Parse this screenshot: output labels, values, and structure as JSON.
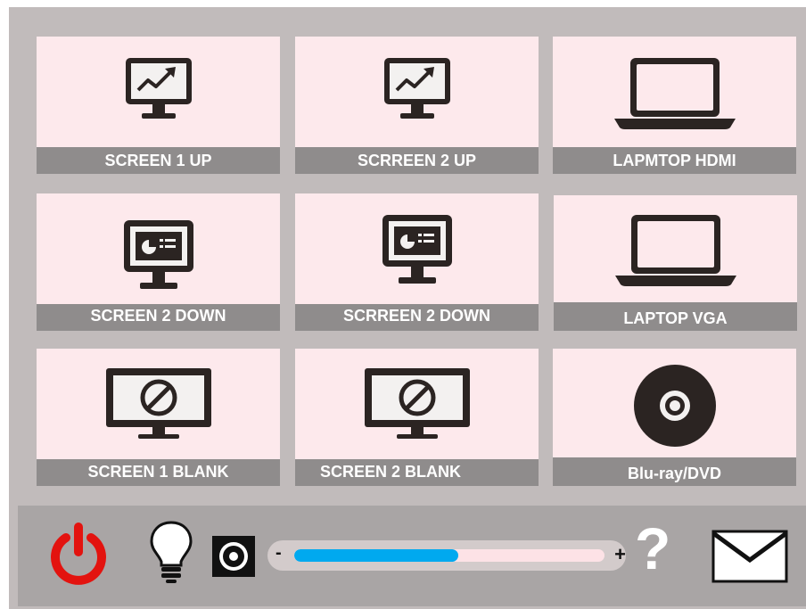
{
  "sources": [
    {
      "label": "SCREEN  1 UP",
      "icon": "monitor-chart-icon"
    },
    {
      "label": "SCRREEN  2 UP",
      "icon": "monitor-chart-icon"
    },
    {
      "label": "LAPMTOP HDMI",
      "icon": "laptop-icon"
    },
    {
      "label": "SCREEN  2 DOWN",
      "icon": "monitor-presentation-icon"
    },
    {
      "label": "SCRREEN  2 DOWN",
      "icon": "monitor-presentation-icon"
    },
    {
      "label": "LAPTOP VGA",
      "icon": "laptop-icon"
    },
    {
      "label": "SCREEN 1 BLANK",
      "icon": "monitor-blank-icon"
    },
    {
      "label": "SCREEN 2 BLANK",
      "icon": "monitor-blank-icon"
    },
    {
      "label": "Blu-ray/DVD",
      "icon": "disc-icon"
    }
  ],
  "controls": {
    "power_icon": "power-icon",
    "light_icon": "lightbulb-icon",
    "speaker_icon": "speaker-icon",
    "volume": {
      "minus_label": "-",
      "plus_label": "+",
      "level_percent": 53
    },
    "help_label": "?",
    "mail_icon": "envelope-icon"
  },
  "colors": {
    "tile_bg": "#fde9ec",
    "label_bg": "#8f8c8c",
    "panel_bg": "#c1bbbb",
    "bar_bg": "#a9a5a5",
    "power": "#e3130f",
    "volume_fill": "#00a9ef"
  }
}
